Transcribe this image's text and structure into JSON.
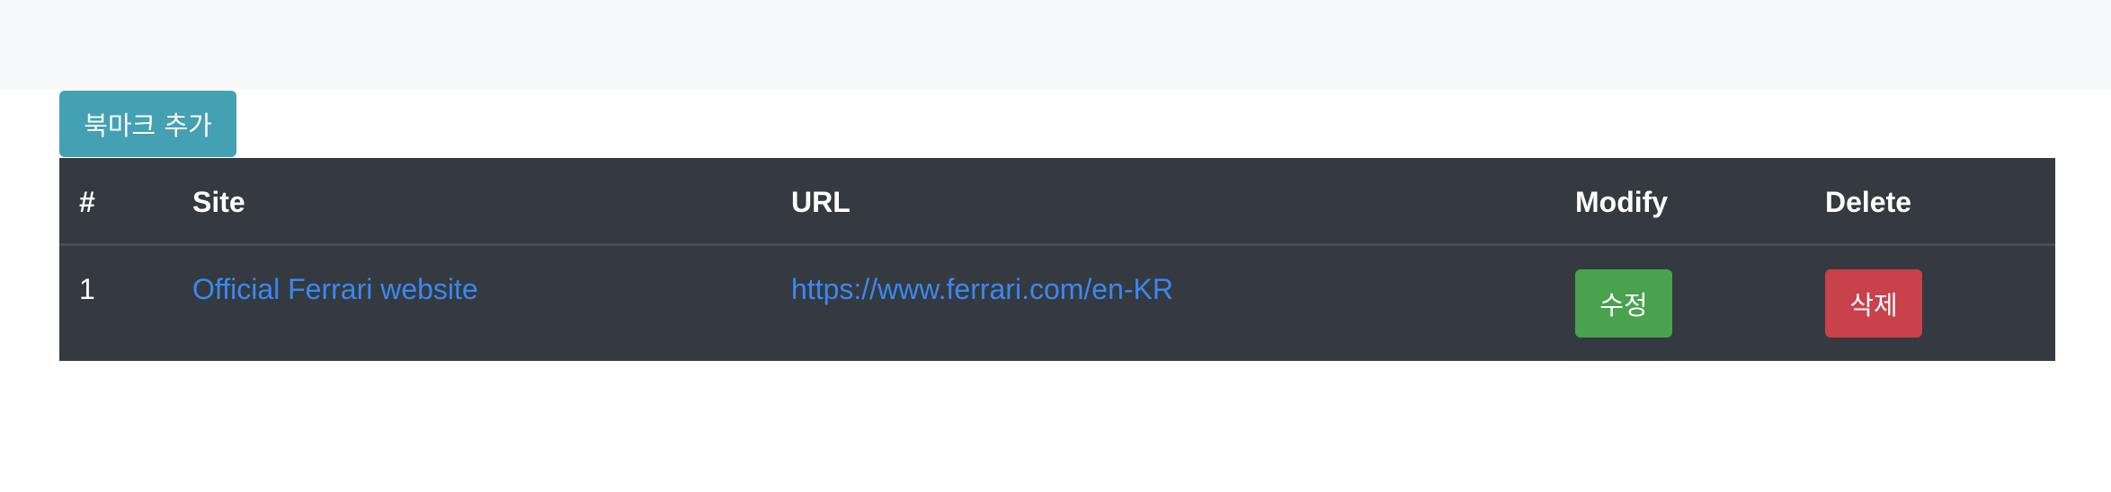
{
  "toolbar": {
    "add_bookmark_label": "북마크 추가"
  },
  "table": {
    "headers": {
      "num": "#",
      "site": "Site",
      "url": "URL",
      "modify": "Modify",
      "delete": "Delete"
    },
    "rows": [
      {
        "num": "1",
        "site": "Official Ferrari website",
        "url": "https://www.ferrari.com/en-KR",
        "modify_label": "수정",
        "delete_label": "삭제"
      }
    ]
  },
  "colors": {
    "topbar_bg": "#f8f9fa",
    "add_button": "#43a1b3",
    "table_bg": "#343a40",
    "link": "#3a88f0",
    "modify_button": "#4aa14e",
    "delete_button": "#c9414a"
  }
}
